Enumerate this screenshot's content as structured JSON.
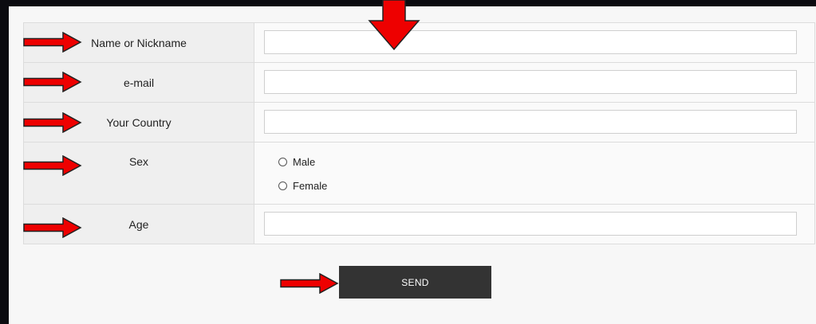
{
  "form": {
    "fields": [
      {
        "label": "Name or Nickname",
        "value": ""
      },
      {
        "label": "e-mail",
        "value": ""
      },
      {
        "label": "Your Country",
        "value": ""
      },
      {
        "label": "Sex",
        "options": [
          "Male",
          "Female"
        ]
      },
      {
        "label": "Age",
        "value": ""
      }
    ],
    "send_label": "SEND"
  },
  "colors": {
    "arrow_fill": "#ee0000",
    "arrow_stroke": "#222222",
    "button_bg": "#333333"
  }
}
